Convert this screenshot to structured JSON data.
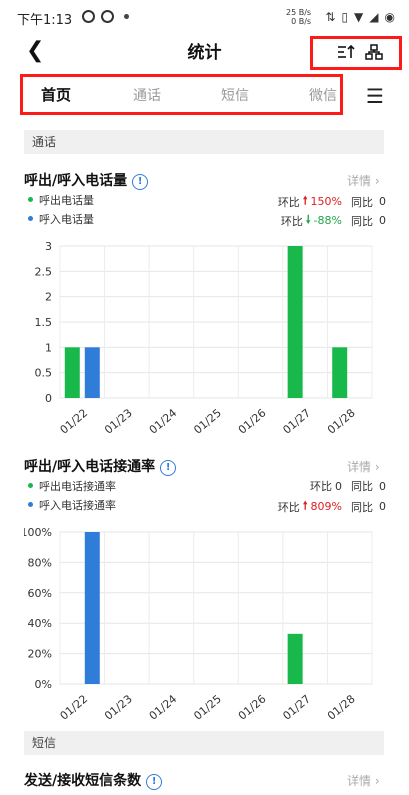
{
  "status_bar": {
    "time": "下午1:13",
    "speed_up": "25 B/s",
    "speed_down": "0 B/s"
  },
  "header": {
    "title": "统计"
  },
  "tabs": [
    "首页",
    "通话",
    "短信",
    "微信"
  ],
  "sections": {
    "calls": "通话",
    "sms": "短信"
  },
  "cards": [
    {
      "title": "呼出/呼入电话量",
      "detail": "详情",
      "legend": [
        {
          "name": "呼出电话量",
          "color": "#19b84b",
          "ring_label": "环比",
          "ring_value": "150%",
          "ring_trend": "up",
          "yoy_label": "同比",
          "yoy_value": "0"
        },
        {
          "name": "呼入电话量",
          "color": "#2f7dd9",
          "ring_label": "环比",
          "ring_value": "-88%",
          "ring_trend": "down",
          "yoy_label": "同比",
          "yoy_value": "0"
        }
      ]
    },
    {
      "title": "呼出/呼入电话接通率",
      "detail": "详情",
      "legend": [
        {
          "name": "呼出电话接通率",
          "color": "#19b84b",
          "ring_label": "环比",
          "ring_value": "0",
          "ring_trend": "none",
          "yoy_label": "同比",
          "yoy_value": "0"
        },
        {
          "name": "呼入电话接通率",
          "color": "#2f7dd9",
          "ring_label": "环比",
          "ring_value": "809%",
          "ring_trend": "up",
          "yoy_label": "同比",
          "yoy_value": "0"
        }
      ]
    },
    {
      "title": "发送/接收短信条数",
      "detail": "详情"
    }
  ],
  "chart_data": [
    {
      "type": "bar",
      "categories": [
        "01/22",
        "01/23",
        "01/24",
        "01/25",
        "01/26",
        "01/27",
        "01/28"
      ],
      "series": [
        {
          "name": "呼出电话量",
          "color": "#19b84b",
          "values": [
            1,
            0,
            0,
            0,
            0,
            3,
            1
          ]
        },
        {
          "name": "呼入电话量",
          "color": "#2f7dd9",
          "values": [
            1,
            0,
            0,
            0,
            0,
            0,
            0
          ]
        }
      ],
      "yticks": [
        "0",
        "0.5",
        "1",
        "1.5",
        "2",
        "2.5",
        "3"
      ],
      "ylim": [
        0,
        3
      ],
      "grid": true
    },
    {
      "type": "bar",
      "categories": [
        "01/22",
        "01/23",
        "01/24",
        "01/25",
        "01/26",
        "01/27",
        "01/28"
      ],
      "series": [
        {
          "name": "呼出电话接通率",
          "color": "#19b84b",
          "values": [
            0,
            0,
            0,
            0,
            0,
            33,
            0
          ]
        },
        {
          "name": "呼入电话接通率",
          "color": "#2f7dd9",
          "values": [
            100,
            0,
            0,
            0,
            0,
            0,
            0
          ]
        }
      ],
      "yticks": [
        "0%",
        "20%",
        "40%",
        "60%",
        "80%",
        "100%"
      ],
      "ylim": [
        0,
        100
      ],
      "grid": true
    }
  ]
}
